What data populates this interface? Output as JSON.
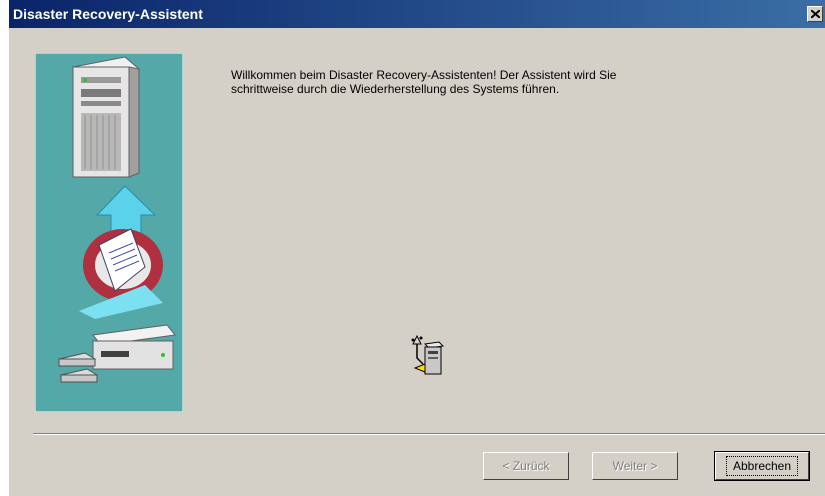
{
  "window": {
    "title": "Disaster Recovery-Assistent",
    "close_symbol": "✕"
  },
  "content": {
    "welcome_text": "Willkommen beim Disaster Recovery-Assistenten! Der Assistent wird Sie schrittweise durch die Wiederherstellung des Systems führen."
  },
  "buttons": {
    "back": "< Zurück",
    "next": "Weiter >",
    "cancel": "Abbrechen"
  },
  "icons": {
    "side_panel": "recovery-illustration",
    "center": "server-restore-icon"
  },
  "colors": {
    "titlebar": "#0a246a",
    "panel_bg": "#54a8a8",
    "window_bg": "#d4d0c8"
  }
}
